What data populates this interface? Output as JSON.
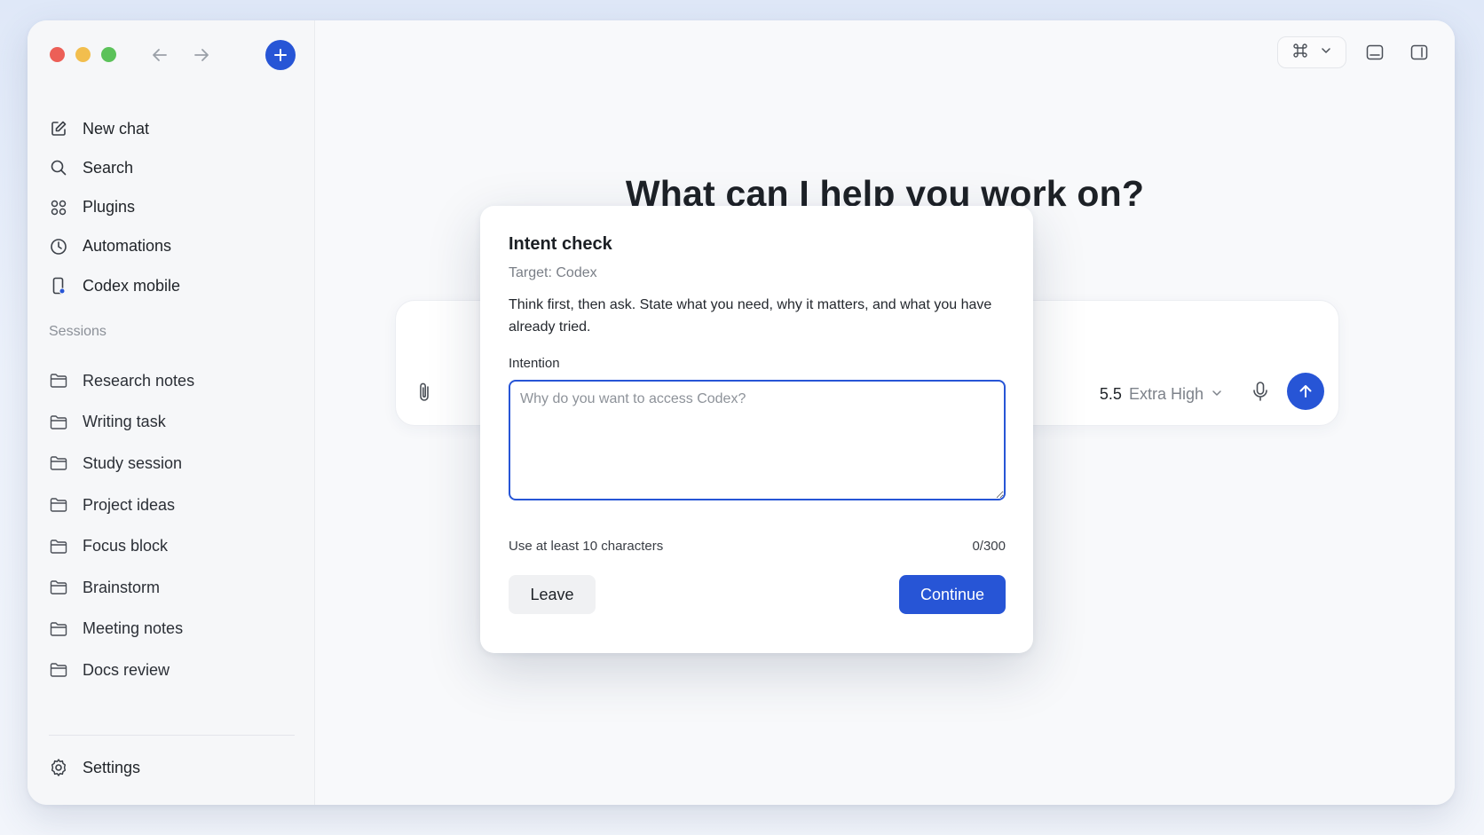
{
  "sidebar": {
    "menu": [
      {
        "label": "New chat",
        "icon": "edit-icon"
      },
      {
        "label": "Search",
        "icon": "search-icon"
      },
      {
        "label": "Plugins",
        "icon": "plugins-icon"
      },
      {
        "label": "Automations",
        "icon": "clock-icon"
      },
      {
        "label": "Codex mobile",
        "icon": "mobile-icon"
      }
    ],
    "sessions_label": "Sessions",
    "sessions": [
      {
        "label": "Research notes"
      },
      {
        "label": "Writing task"
      },
      {
        "label": "Study session"
      },
      {
        "label": "Project ideas"
      },
      {
        "label": "Focus block"
      },
      {
        "label": "Brainstorm"
      },
      {
        "label": "Meeting notes"
      },
      {
        "label": "Docs review"
      }
    ],
    "settings_label": "Settings"
  },
  "main": {
    "hero": "What can I help you work on?",
    "composer": {
      "model_version": "5.5",
      "model_effort": "Extra High"
    }
  },
  "modal": {
    "title": "Intent check",
    "target": "Target: Codex",
    "description": "Think first, then ask. State what you need, why it matters, and what you have already tried.",
    "field_label": "Intention",
    "placeholder": "Why do you want to access Codex?",
    "value": "",
    "hint": "Use at least 10 characters",
    "counter": "0/300",
    "leave_label": "Leave",
    "continue_label": "Continue"
  },
  "colors": {
    "accent": "#2755d6",
    "traffic_red": "#ec5f57",
    "traffic_yellow": "#f2be4e",
    "traffic_green": "#5cc25a"
  }
}
